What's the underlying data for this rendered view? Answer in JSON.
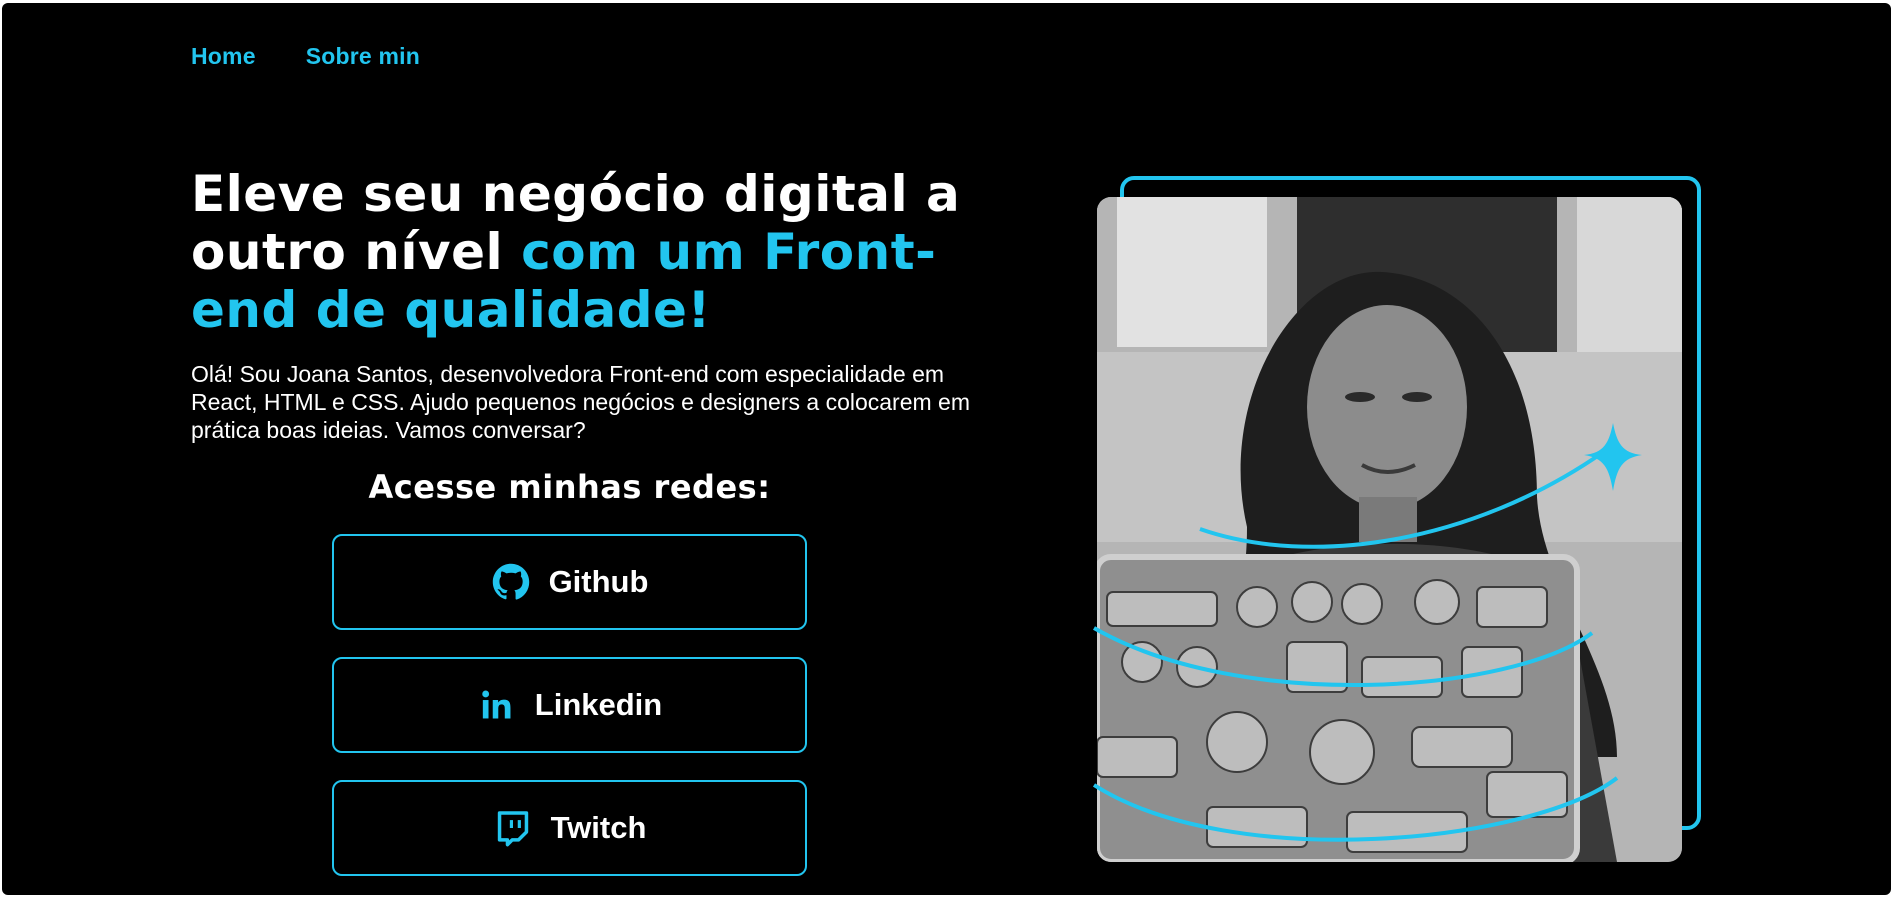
{
  "nav": {
    "home": "Home",
    "about": "Sobre min"
  },
  "hero": {
    "headline_part1": "Eleve seu negócio digital a outro nível ",
    "headline_accent": "com um Front-end de qualidade!",
    "intro": "Olá! Sou Joana Santos, desenvolvedora Front-end com especialidade em React, HTML e CSS. Ajudo pequenos negócios e designers a colocarem em prática boas ideias. Vamos conversar?"
  },
  "networks": {
    "title": "Acesse minhas redes:",
    "items": [
      {
        "label": "Github",
        "icon": "github-icon"
      },
      {
        "label": "Linkedin",
        "icon": "linkedin-icon"
      },
      {
        "label": "Twitch",
        "icon": "twitch-icon"
      }
    ]
  },
  "colors": {
    "accent": "#22c5ef",
    "background": "#000000",
    "text": "#ffffff"
  }
}
